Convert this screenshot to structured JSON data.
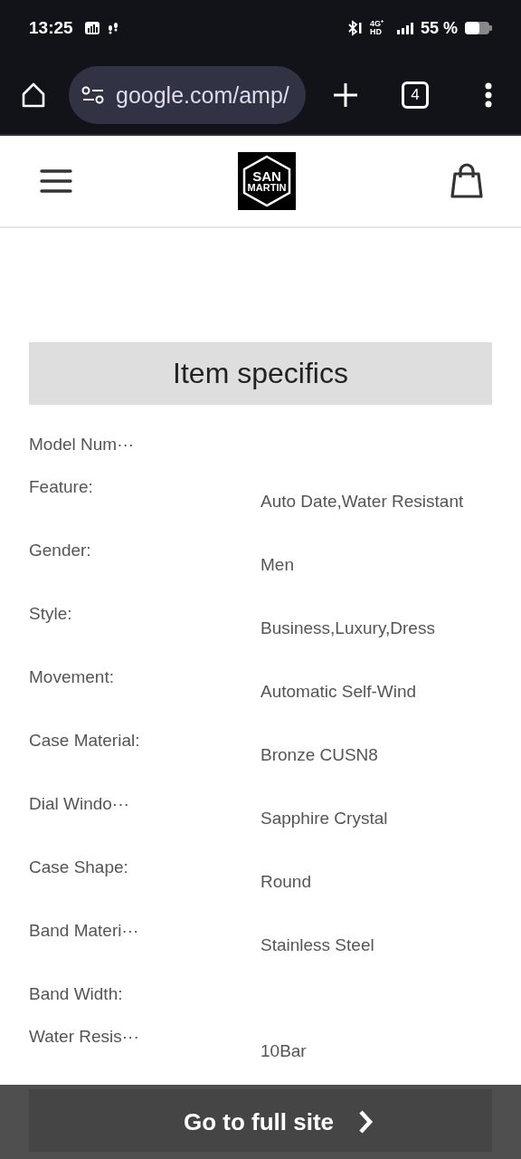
{
  "status_bar": {
    "time": "13:25",
    "network": "4G⁺ HD",
    "battery": "55 %"
  },
  "browser": {
    "url": "google.com/amp/",
    "tab_count": "4"
  },
  "site_header": {
    "logo_lines": [
      "SAN",
      "MARTIN"
    ]
  },
  "item_specifics": {
    "title": "Item specifics",
    "rows": [
      {
        "label": "Model Num···"
      },
      {
        "label": "Feature:",
        "value": "Auto Date,Water Resistant"
      },
      {
        "label": "Gender:",
        "value": "Men"
      },
      {
        "label": "Style:",
        "value": "Business,Luxury,Dress"
      },
      {
        "label": "Movement:",
        "value": "Automatic Self-Wind"
      },
      {
        "label": "Case Material:",
        "value": "Bronze CUSN8"
      },
      {
        "label": "Dial Windo···",
        "value": "Sapphire Crystal"
      },
      {
        "label": "Case Shape:",
        "value": "Round"
      },
      {
        "label": "Band Materi···",
        "value": "Stainless Steel"
      },
      {
        "label": "Band Width:"
      },
      {
        "label": "Water Resis···",
        "value": "10Bar"
      }
    ]
  },
  "full_site_banner": {
    "label": "Go to full site"
  }
}
